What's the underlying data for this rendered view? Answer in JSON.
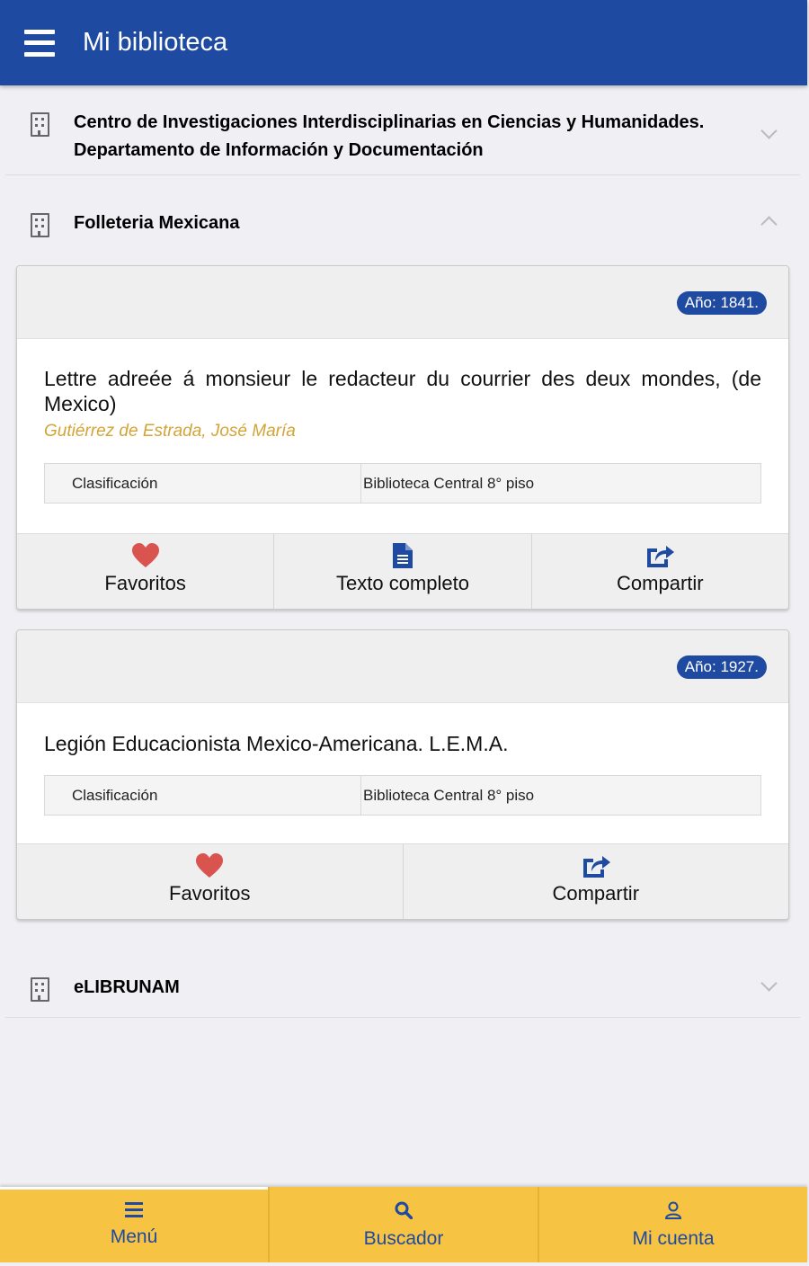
{
  "appbar": {
    "title": "Mi biblioteca"
  },
  "groups": [
    {
      "name_line1": "Centro de Investigaciones Interdisciplinarias en Ciencias y Humanidades.",
      "name_line2": "Departamento de Información y Documentación",
      "expanded": false
    },
    {
      "name": "Folleteria Mexicana",
      "expanded": true
    },
    {
      "name": "eLIBRUNAM",
      "expanded": false
    }
  ],
  "records": [
    {
      "year_badge": "Año: 1841.",
      "title": "Lettre adreée á monsieur le redacteur du courrier des deux mondes, (de Mexico)",
      "author": "Gutiérrez de Estrada, José María",
      "info_key": "Clasificación",
      "info_value": "Biblioteca Central 8° piso",
      "actions": {
        "favorites": "Favoritos",
        "fulltext": "Texto completo",
        "share": "Compartir"
      }
    },
    {
      "year_badge": "Año: 1927.",
      "title": "Legión Educacionista Mexico-Americana. L.E.M.A.",
      "info_key": "Clasificación",
      "info_value": "Biblioteca Central 8° piso",
      "actions": {
        "favorites": "Favoritos",
        "share": "Compartir"
      }
    }
  ],
  "bottom_nav": [
    {
      "label": "Menú",
      "icon": "menu-icon",
      "active": true
    },
    {
      "label": "Buscador",
      "icon": "search-icon",
      "active": false
    },
    {
      "label": "Mi cuenta",
      "icon": "user-icon",
      "active": false
    }
  ],
  "colors": {
    "primary": "#1f4aa2",
    "accent": "#f6c342",
    "author": "#d3a436",
    "favorite": "#d9534f"
  }
}
